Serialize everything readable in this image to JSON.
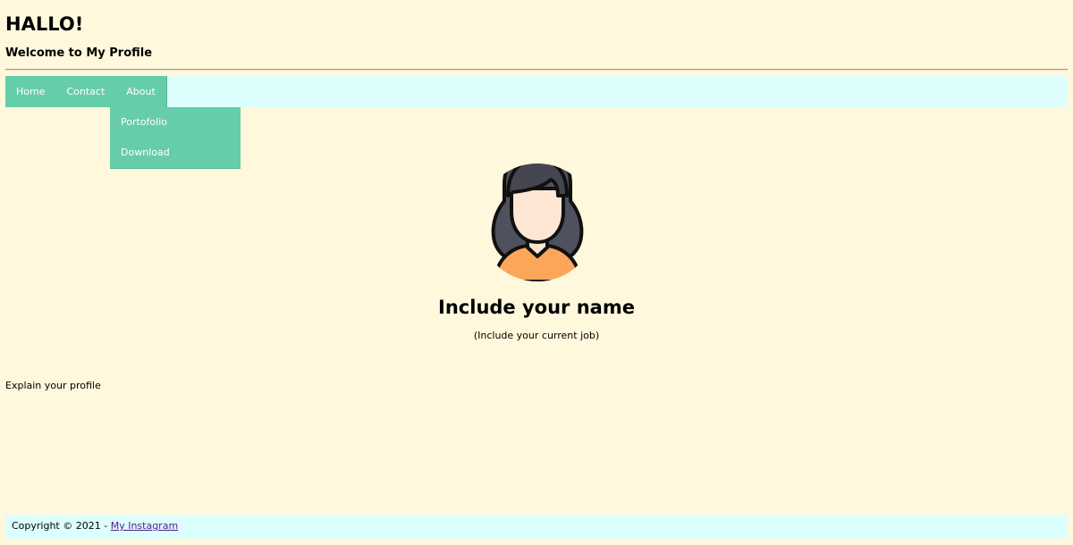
{
  "header": {
    "title": "HALLO!",
    "subtitle": "Welcome to My Profile"
  },
  "nav": {
    "items": [
      {
        "label": "Home"
      },
      {
        "label": "Contact"
      },
      {
        "label": "About"
      }
    ],
    "dropdown": [
      {
        "label": "Portofolio"
      },
      {
        "label": "Download"
      }
    ]
  },
  "profile": {
    "avatar_icon": "woman-avatar-icon",
    "name": "Include your name",
    "job": "(Include your current job)",
    "description": "Explain your profile"
  },
  "footer": {
    "copyright": "Copyright © 2021 - ",
    "link_label": "My Instagram"
  },
  "colors": {
    "page_background": "#fff8dc",
    "nav_background": "#dcfffe",
    "menu_accent": "#66cdaa",
    "link": "#551a8b"
  }
}
